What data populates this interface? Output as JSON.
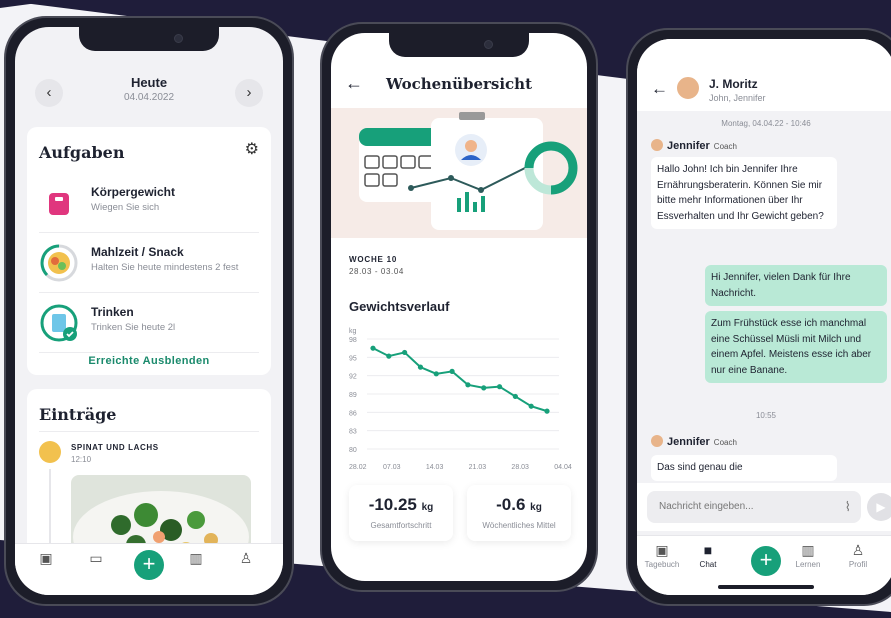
{
  "colors": {
    "accent": "#17a07a",
    "navy": "#1f1d3a",
    "bubble_out": "#b9e9d6",
    "background": "#f3f3f7"
  },
  "phone1": {
    "header": {
      "title": "Heute",
      "date": "04.04.2022",
      "prev_icon": "chevron-left-icon",
      "next_icon": "chevron-right-icon"
    },
    "tasks_card": {
      "title": "Aufgaben",
      "settings_icon": "gear-icon",
      "items": [
        {
          "title": "Körpergewicht",
          "subtitle": "Wiegen Sie sich",
          "icon": "scale-icon"
        },
        {
          "title": "Mahlzeit / Snack",
          "subtitle": "Halten Sie heute mindestens 2 fest",
          "icon": "meal-icon"
        },
        {
          "title": "Trinken",
          "subtitle": "Trinken Sie heute 2l",
          "icon": "water-glass-icon"
        }
      ],
      "hide_completed": "Erreichte Ausblenden"
    },
    "entries_card": {
      "title": "Einträge",
      "entry": {
        "title": "SPINAT UND LACHS",
        "time": "12:10"
      }
    }
  },
  "phone2": {
    "title": "Wochenübersicht",
    "back_icon": "arrow-left-icon",
    "week_label": "WOCHE 10",
    "week_range": "28.03 - 03.04",
    "chart_title": "Gewichtsverlauf",
    "chart_data": {
      "type": "line",
      "title": "Gewichtsverlauf",
      "ylabel": "kg",
      "ylim": [
        80,
        98
      ],
      "yticks": [
        "98",
        "95",
        "92",
        "89",
        "86",
        "83",
        "80"
      ],
      "x_tick_labels": [
        "28.02",
        "07.03",
        "14.03",
        "21.03",
        "28.03",
        "04.04"
      ],
      "series": [
        {
          "values": [
            96.5,
            95.2,
            95.8,
            93.4,
            92.3,
            92.7,
            90.5,
            90,
            90.2,
            88.6,
            87,
            86.2
          ]
        }
      ],
      "grid": true
    },
    "stats": [
      {
        "value": "-10.25",
        "unit": "kg",
        "label": "Gesamtfortschritt"
      },
      {
        "value": "-0.6",
        "unit": "kg",
        "label": "Wöchentliches Mittel"
      }
    ]
  },
  "phone3": {
    "contact_name": "J. Moritz",
    "participants": "John, Jennifer",
    "date_stamp": "Montag, 04.04.22 - 10:46",
    "sender_name": "Jennifer",
    "sender_role": "Coach",
    "messages": [
      {
        "text": "Hallo John! Ich bin Jennifer Ihre Ernährungsberaterin. Können Sie mir bitte mehr Informationen über Ihr Essverhalten und Ihr Gewicht geben?"
      },
      {
        "text": "Hi Jennifer, vielen Dank für Ihre Nachricht."
      },
      {
        "text": "Zum Frühstück esse ich manchmal eine Schüssel Müsli mit Milch und einem Apfel. Meistens esse ich aber nur eine Banane."
      },
      {
        "text": "Das sind genau die"
      }
    ],
    "time_stamp": "10:55",
    "input_placeholder": "Nachricht eingeben...",
    "tabs": [
      "Tagebuch",
      "Chat",
      "Lernen",
      "Profil"
    ]
  }
}
